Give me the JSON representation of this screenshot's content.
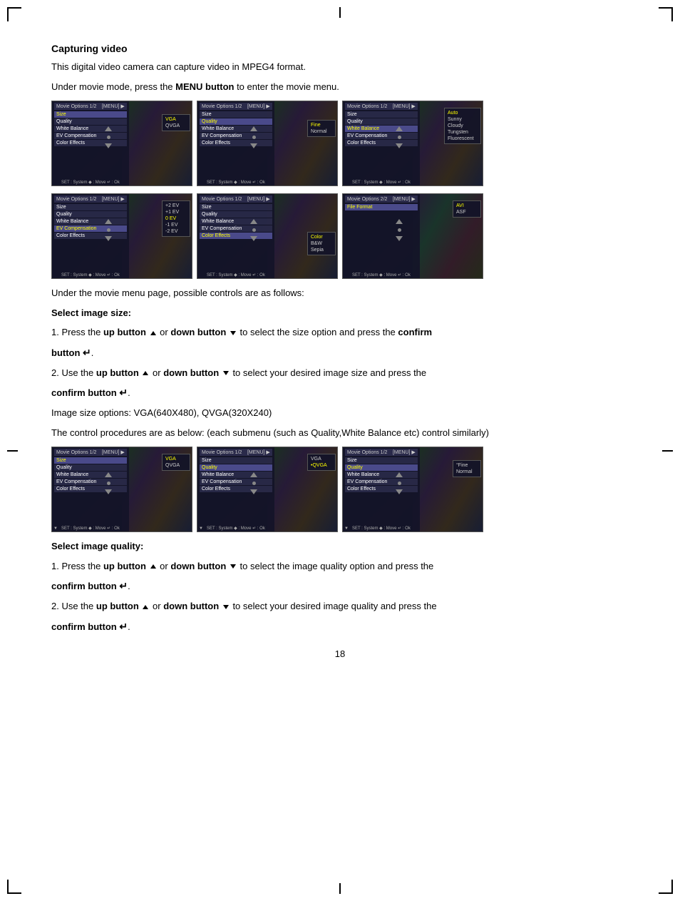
{
  "page": {
    "title": "Capturing video",
    "intro": "This digital video camera can capture video in MPEG4 format.",
    "menu_intro": "Under movie mode, press the ",
    "menu_intro_bold": "MENU button",
    "menu_intro_end": " to enter the movie menu.",
    "section1_label": "Under the movie menu page, possible controls are as follows:",
    "select_size_label": "Select image size:",
    "step1_text_pre": "1. Press the ",
    "step1_up": "up button",
    "step1_or": " or ",
    "step1_down": "down button",
    "step1_post": " to select the size option and press the ",
    "step1_confirm": "confirm button",
    "step1_end": ".",
    "step2_text_pre": "2. Use the ",
    "step2_up": "up button",
    "step2_or": " or ",
    "step2_down": "down button",
    "step2_post": " to select your desired image size and press the",
    "step2_confirm": "confirm button",
    "step2_end": ".",
    "image_size_options": "Image size options: VGA(640X480), QVGA(320X240)",
    "control_note": "The control procedures are as below: (each submenu (such as Quality,White Balance etc) control similarly)",
    "select_quality_label": "Select image quality:",
    "q_step1_text_pre": "1. Press the ",
    "q_step1_up": "up button",
    "q_step1_or": " or ",
    "q_step1_down": "down button",
    "q_step1_post": " to select the image quality option and press the",
    "q_step1_confirm": "confirm button",
    "q_step1_end": ".",
    "q_step2_text_pre": "2. Use the ",
    "q_step2_up": "up button",
    "q_step2_or": " or ",
    "q_step2_down": "down button",
    "q_step2_post": " to select your desired image quality and press the",
    "q_step2_confirm": "confirm button",
    "q_step2_end": ".",
    "page_number": "18"
  },
  "menu_items": [
    "Size",
    "Quality",
    "White Balance",
    "EV Compensation",
    "Color Effects"
  ],
  "screen_labels": {
    "movie_options_1": "Movie Options  1/2",
    "movie_options_2": "Movie Options  2/2",
    "menu_tag": "[MENU]",
    "set_system": "SET : System",
    "move": "Move",
    "ok": "Ok"
  },
  "submenu_size": [
    "VGA",
    "QVGA"
  ],
  "submenu_fine": [
    "Fine",
    "Normal"
  ],
  "submenu_wb": [
    "Auto",
    "Sunny",
    "Cloudy",
    "Tungsten",
    "Fluorescent"
  ],
  "submenu_ev": [
    "+2 EV",
    "+1 EV",
    "0 EV",
    "-1 EV",
    "-2 EV"
  ],
  "submenu_color": [
    "Color",
    "B&W",
    "Sepia"
  ],
  "submenu_format": [
    "AVI",
    "ASF"
  ],
  "file_format": "File Format"
}
